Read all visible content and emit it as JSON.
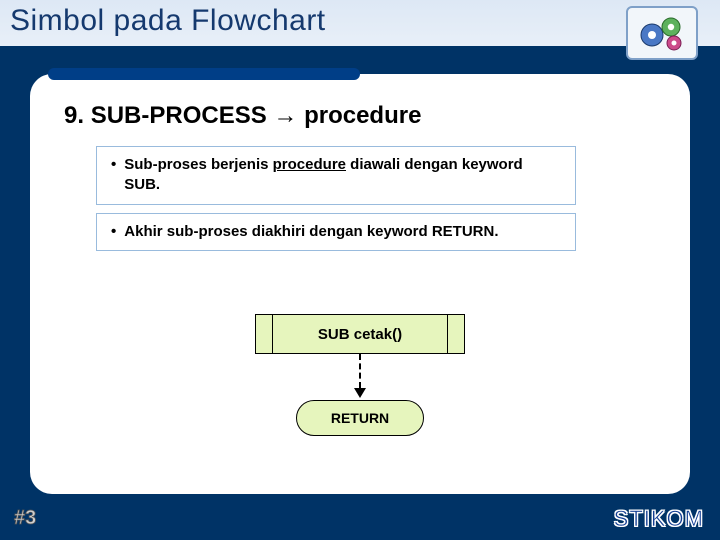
{
  "title": "Simbol pada Flowchart",
  "heading_prefix": "9.",
  "heading_keyword": "SUB-PROCESS",
  "heading_arrow": "→",
  "heading_suffix": "procedure",
  "bullets": [
    {
      "pre": "Sub-proses berjenis ",
      "under": "procedure",
      "post": " diawali dengan keyword SUB."
    },
    {
      "pre": "Akhir sub-proses diakhiri dengan keyword RETURN.",
      "under": "",
      "post": ""
    }
  ],
  "flow": {
    "sub_label": "SUB cetak()",
    "return_label": "RETURN"
  },
  "page_number": "#3",
  "brand": "STIKOM"
}
